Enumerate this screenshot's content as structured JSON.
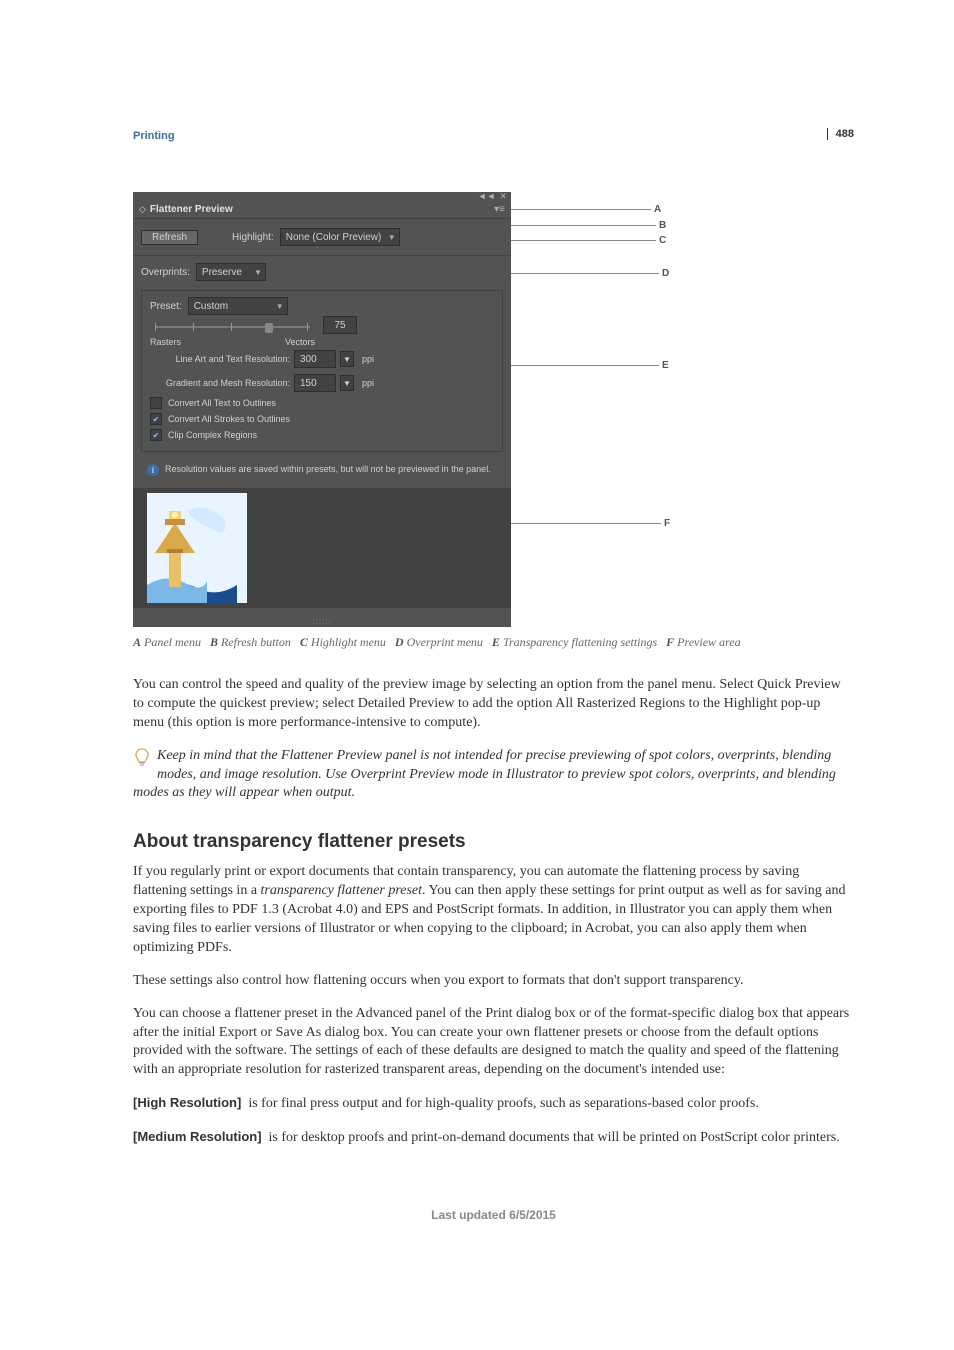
{
  "page_number": "488",
  "section_header": "Printing",
  "panel": {
    "title": "Flattener Preview",
    "refresh_label": "Refresh",
    "highlight_label": "Highlight:",
    "highlight_value": "None (Color Preview)",
    "overprint_label": "Overprints:",
    "overprint_value": "Preserve",
    "preset_label": "Preset:",
    "preset_value": "Custom",
    "slider_value": "75",
    "slider_left": "Rasters",
    "slider_right": "Vectors",
    "line_art_label": "Line Art and Text Resolution:",
    "line_art_value": "300",
    "gradient_label": "Gradient and Mesh Resolution:",
    "gradient_value": "150",
    "ppi1": "ppi",
    "ppi2": "ppi",
    "convert_text": "Convert All Text to Outlines",
    "convert_strokes": "Convert All Strokes to Outlines",
    "clip_regions": "Clip Complex Regions",
    "info_text": "Resolution values are saved within presets, but will not be previewed in the panel."
  },
  "callouts": {
    "A": "A",
    "B": "B",
    "C": "C",
    "D": "D",
    "E": "E",
    "F": "F"
  },
  "caption": {
    "a_label": "A",
    "a_text": "Panel menu",
    "b_label": "B",
    "b_text": "Refresh button",
    "c_label": "C",
    "c_text": "Highlight menu",
    "d_label": "D",
    "d_text": "Overprint menu",
    "e_label": "E",
    "e_text": "Transparency flattening settings",
    "f_label": "F",
    "f_text": "Preview area"
  },
  "body1": "You can control the speed and quality of the preview image by selecting an option from the panel menu. Select Quick Preview to compute the quickest preview; select Detailed Preview to add the option All Rasterized Regions to the Highlight pop-up menu (this option is more performance-intensive to compute).",
  "tip": "Keep in mind that the Flattener Preview panel is not intended for precise previewing of spot colors, overprints, blending modes, and image resolution. Use Overprint Preview mode in Illustrator to preview spot colors, overprints, and blending modes as they will appear when output.",
  "heading2": "About transparency flattener presets",
  "body2a": "If you regularly print or export documents that contain transparency, you can automate the flattening process by saving flattening settings in a ",
  "body2_italic": "transparency flattener preset",
  "body2b": ". You can then apply these settings for print output as well as for saving and exporting files to PDF 1.3 (Acrobat 4.0) and EPS and PostScript formats. In addition, in Illustrator you can apply them when saving files to earlier versions of Illustrator or when copying to the clipboard; in Acrobat, you can also apply them when optimizing PDFs.",
  "body3": "These settings also control how flattening occurs when you export to formats that don't support transparency.",
  "body4": "You can choose a flattener preset in the Advanced panel of the Print dialog box or of the format-specific dialog box that appears after the initial Export or Save As dialog box. You can create your own flattener presets or choose from the default options provided with the software. The settings of each of these defaults are designed to match the quality and speed of the flattening with an appropriate resolution for rasterized transparent areas, depending on the document's intended use:",
  "def1_term": "[High Resolution]",
  "def1_text": "is for final press output and for high-quality proofs, such as separations-based color proofs.",
  "def2_term": "[Medium Resolution]",
  "def2_text": "is for desktop proofs and print-on-demand documents that will be printed on PostScript color printers.",
  "footer": "Last updated 6/5/2015"
}
